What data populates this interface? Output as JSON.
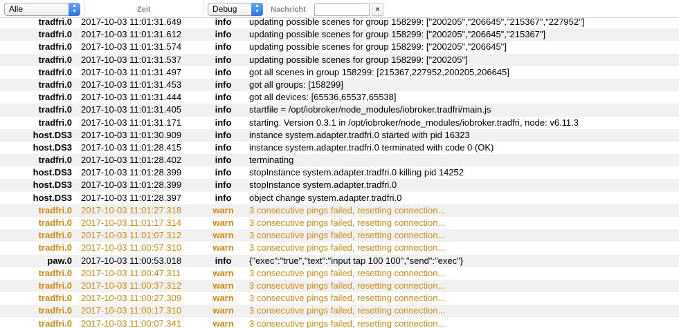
{
  "filter": {
    "source_value": "Alle",
    "time_label": "Zeit",
    "level_value": "Debug",
    "message_label": "Nachricht",
    "message_value": "",
    "clear_label": "×"
  },
  "colors": {
    "warn": "#d08a14",
    "info": "#000000",
    "alt_row": "#f1f1f1"
  },
  "rows": [
    {
      "src": "tradfri.0",
      "time": "2017-10-03 11:01:31.649",
      "level": "info",
      "msg": "updating possible scenes for group 158299: [\"200205\",\"206645\",\"215367\",\"227952\"]"
    },
    {
      "src": "tradfri.0",
      "time": "2017-10-03 11:01:31.612",
      "level": "info",
      "msg": "updating possible scenes for group 158299: [\"200205\",\"206645\",\"215367\"]"
    },
    {
      "src": "tradfri.0",
      "time": "2017-10-03 11:01:31.574",
      "level": "info",
      "msg": "updating possible scenes for group 158299: [\"200205\",\"206645\"]"
    },
    {
      "src": "tradfri.0",
      "time": "2017-10-03 11:01:31.537",
      "level": "info",
      "msg": "updating possible scenes for group 158299: [\"200205\"]"
    },
    {
      "src": "tradfri.0",
      "time": "2017-10-03 11:01:31.497",
      "level": "info",
      "msg": "got all scenes in group 158299: [215367,227952,200205,206645]"
    },
    {
      "src": "tradfri.0",
      "time": "2017-10-03 11:01:31.453",
      "level": "info",
      "msg": "got all groups: [158299]"
    },
    {
      "src": "tradfri.0",
      "time": "2017-10-03 11:01:31.444",
      "level": "info",
      "msg": "got all devices: [65536,65537,65538]"
    },
    {
      "src": "tradfri.0",
      "time": "2017-10-03 11:01:31.405",
      "level": "info",
      "msg": "startfile = /opt/iobroker/node_modules/iobroker.tradfri/main.js"
    },
    {
      "src": "tradfri.0",
      "time": "2017-10-03 11:01:31.171",
      "level": "info",
      "msg": "starting. Version 0.3.1 in /opt/iobroker/node_modules/iobroker.tradfri, node: v6.11.3"
    },
    {
      "src": "host.DS3",
      "time": "2017-10-03 11:01:30.909",
      "level": "info",
      "msg": "instance system.adapter.tradfri.0 started with pid 16323"
    },
    {
      "src": "host.DS3",
      "time": "2017-10-03 11:01:28.415",
      "level": "info",
      "msg": "instance system.adapter.tradfri.0 terminated with code 0 (OK)"
    },
    {
      "src": "tradfri.0",
      "time": "2017-10-03 11:01:28.402",
      "level": "info",
      "msg": "terminating"
    },
    {
      "src": "host.DS3",
      "time": "2017-10-03 11:01:28.399",
      "level": "info",
      "msg": "stopInstance system.adapter.tradfri.0 killing pid 14252"
    },
    {
      "src": "host.DS3",
      "time": "2017-10-03 11:01:28.399",
      "level": "info",
      "msg": "stopInstance system.adapter.tradfri.0"
    },
    {
      "src": "host.DS3",
      "time": "2017-10-03 11:01:28.397",
      "level": "info",
      "msg": "object change system.adapter.tradfri.0"
    },
    {
      "src": "tradfri.0",
      "time": "2017-10-03 11:01:27.318",
      "level": "warn",
      "msg": "3 consecutive pings failed, resetting connection..."
    },
    {
      "src": "tradfri.0",
      "time": "2017-10-03 11:01:17.314",
      "level": "warn",
      "msg": "3 consecutive pings failed, resetting connection..."
    },
    {
      "src": "tradfri.0",
      "time": "2017-10-03 11:01:07.312",
      "level": "warn",
      "msg": "3 consecutive pings failed, resetting connection..."
    },
    {
      "src": "tradfri.0",
      "time": "2017-10-03 11:00:57.310",
      "level": "warn",
      "msg": "3 consecutive pings failed, resetting connection..."
    },
    {
      "src": "paw.0",
      "time": "2017-10-03 11:00:53.018",
      "level": "info",
      "msg": "{\"exec\":\"true\",\"text\":\"input tap 100 100\",\"send\":\"exec\"}"
    },
    {
      "src": "tradfri.0",
      "time": "2017-10-03 11:00:47.311",
      "level": "warn",
      "msg": "3 consecutive pings failed, resetting connection..."
    },
    {
      "src": "tradfri.0",
      "time": "2017-10-03 11:00:37.312",
      "level": "warn",
      "msg": "3 consecutive pings failed, resetting connection..."
    },
    {
      "src": "tradfri.0",
      "time": "2017-10-03 11:00:27.309",
      "level": "warn",
      "msg": "3 consecutive pings failed, resetting connection..."
    },
    {
      "src": "tradfri.0",
      "time": "2017-10-03 11:00:17.310",
      "level": "warn",
      "msg": "3 consecutive pings failed, resetting connection..."
    },
    {
      "src": "tradfri.0",
      "time": "2017-10-03 11:00:07.341",
      "level": "warn",
      "msg": "3 consecutive pings failed, resetting connection..."
    }
  ]
}
